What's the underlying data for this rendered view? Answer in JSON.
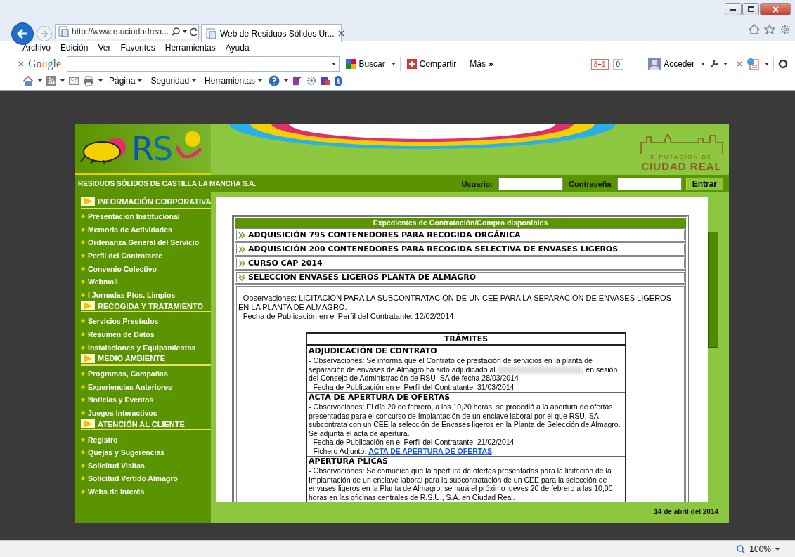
{
  "browser": {
    "address": "http://www.rsuciudadrea...",
    "tab": {
      "title": "Web de Residuos Sólidos Ur...",
      "selected": true
    },
    "menu": [
      "Archivo",
      "Edición",
      "Ver",
      "Favoritos",
      "Herramientas",
      "Ayuda"
    ],
    "google_toolbar": {
      "logo": "Google",
      "search_button": "Buscar",
      "share_button": "Compartir",
      "more_button": "Más **»**",
      "plus_one": "8+1",
      "plus_count": "0",
      "account_button": "Acceder"
    },
    "command_bar": {
      "menus": [
        "Página",
        "Seguridad",
        "Herramientas"
      ]
    },
    "zoom": "100%"
  },
  "site": {
    "header": {
      "logo_text": "RS",
      "council_small": "DIPUTACION DE",
      "council_name": "CIUDAD REAL",
      "tagline": "RESIDUOS SÓLIDOS DE CASTILLA LA MANCHA S.A."
    },
    "login": {
      "user_label": "Usuario:",
      "password_label": "Contraseña",
      "button": "Entrar"
    },
    "nav": [
      {
        "title": "INFORMACIÓN CORPORATIVA",
        "items": [
          "Presentación Institucional",
          "Memoria de Actividades",
          "Ordenanza General del Servicio",
          "Perfil del Contratante",
          "Convenio Colectivo",
          "Webmail",
          "I Jornadas Ptos. Limpios"
        ]
      },
      {
        "title": "RECOGIDA Y TRATAMIENTO",
        "items": [
          "Servicios Prestados",
          "Resumen de Datos",
          "Instalaciones y Equipamientos"
        ]
      },
      {
        "title": "MEDIO AMBIENTE",
        "items": [
          "Programas, Campañas",
          "Experiencias Anteriores",
          "Noticias y Eventos",
          "Juegos Interactivos"
        ]
      },
      {
        "title": "ATENCIÓN AL CLIENTE",
        "items": [
          "Registro",
          "Quejas y Sugerencias",
          "Solicitud Visitas",
          "Solicitud Vertido Almagro",
          "Webs de Interés"
        ]
      }
    ],
    "content": {
      "table_title": "Expedientes de Contratación/Compra disponibles",
      "expedientes": [
        {
          "title": "ADQUISICIÓN 795 CONTENEDORES PARA RECOGIDA ORGÁNICA",
          "expanded": false
        },
        {
          "title": "ADQUISICIÓN 200 CONTENEDORES PARA RECOGIDA SELECTIVA DE ENVASES LIGEROS",
          "expanded": false
        },
        {
          "title": "CURSO CAP 2014",
          "expanded": false
        },
        {
          "title": "SELECCION ENVASES LIGEROS PLANTA DE ALMAGRO",
          "expanded": true
        }
      ],
      "detail": [
        "- Observaciones: LICITACIÓN PARA LA SUBCONTRATACIÓN DE UN CEE PARA LA SEPARACIÓN DE ENVASES LIGEROS EN LA PLANTA DE ALMAGRO.",
        "- Fecha de Publicación en el Perfil del Contratante: 12/02/2014"
      ],
      "tramites": {
        "title": "TRÁMITES",
        "items": [
          {
            "title": "ADJUDICACIÓN DE CONTRATO",
            "lines": [
              {
                "text": "- Observaciones: Se informa que el Contrato de prestación de servicios en la planta de separación de envases de Almagro ha sido adjudicado al",
                "redacted": true,
                "text_after": ", en sesión del Consejo de Administración de RSU, SA de fecha 28/03/2014"
              },
              {
                "text": "- Fecha de Publicación en el Perfil del Contratante: 31/03/2014"
              }
            ]
          },
          {
            "title": "ACTA DE APERTURA DE OFERTAS",
            "lines": [
              {
                "text": "- Observaciones: El día 20 de febrero, a las 10,20 horas, se procedió a la apertura de ofertas presentadas para el concurso de Implantación de un enclave laboral por el que RSU, SA subcontrata con un CEE la selección de Envases ligeros en la Planta de Selección de Almagro. Se adjunta el acta de apertura."
              },
              {
                "text": "- Fecha de Publicación en el Perfil del Contratante: 21/02/2014"
              },
              {
                "text": "- Fichero Adjunto:",
                "link": "ACTA DE APERTURA DE OFERTAS"
              }
            ]
          },
          {
            "title": "APERTURA PLICAS",
            "lines": [
              {
                "text": "- Observaciones: Se comunica que la apertura de ofertas presentadas para la licitación de la Implantación de un enclave laboral para la subcontratación de un CEE para la selección de envases ligeros en la Planta de Almagro, se hará el próximo jueves 20 de febrero a las 10,00 horas en las oficinas centrales de R.S.U., S.A. en Ciudad Real."
              }
            ]
          }
        ]
      }
    },
    "date": "14 de abril del 2014"
  }
}
